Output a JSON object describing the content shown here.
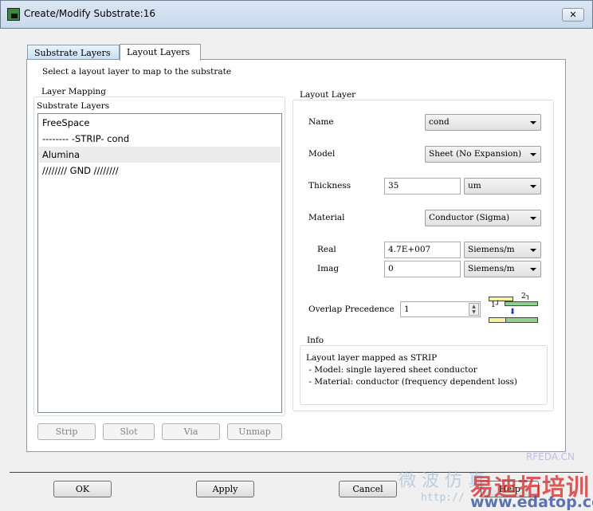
{
  "window": {
    "title": "Create/Modify Substrate:16",
    "close_label": "✕"
  },
  "tabs": [
    {
      "label": "Substrate Layers",
      "active": false
    },
    {
      "label": "Layout Layers",
      "active": true
    }
  ],
  "instruction": "Select a layout layer to map to the substrate",
  "layer_mapping": {
    "group_label": "Layer Mapping",
    "list_label": "Substrate Layers",
    "items": [
      {
        "label": "FreeSpace"
      },
      {
        "label": "-------- -STRIP- cond"
      },
      {
        "label": "Alumina",
        "selected": true
      },
      {
        "label": "//////// GND ////////"
      }
    ],
    "buttons": {
      "strip": "Strip",
      "slot": "Slot",
      "via": "Via",
      "unmap": "Unmap"
    }
  },
  "layout_layer": {
    "group_label": "Layout Layer",
    "name_label": "Name",
    "name_value": "cond",
    "model_label": "Model",
    "model_value": "Sheet (No Expansion)",
    "thickness_label": "Thickness",
    "thickness_value": "35",
    "thickness_unit": "um",
    "material_label": "Material",
    "material_value": "Conductor (Sigma)",
    "real_label": "Real",
    "real_value": "4.7E+007",
    "real_unit": "Siemens/m",
    "imag_label": "Imag",
    "imag_value": "0",
    "imag_unit": "Siemens/m",
    "overlap_label": "Overlap Precedence",
    "overlap_value": "1",
    "overlap_icon_labels": {
      "one": "1┘",
      "two": "2┐"
    }
  },
  "info": {
    "group_label": "Info",
    "lines": [
      "Layout layer mapped as STRIP",
      " - Model: single layered sheet conductor",
      " - Material: conductor (frequency dependent loss)"
    ]
  },
  "footer": {
    "ok": "OK",
    "apply": "Apply",
    "cancel": "Cancel",
    "help": "Help"
  },
  "watermark": {
    "site": "RFEDA.CN",
    "cn1": "微 波 仿 真",
    "brand": "易迪拓培训",
    "url": "www.edatop.com",
    "http": "http://"
  },
  "colors": {
    "overlap_yellow": "#f4f29a",
    "overlap_green": "#8fd08f",
    "arrow_blue": "#1a3cb0"
  }
}
